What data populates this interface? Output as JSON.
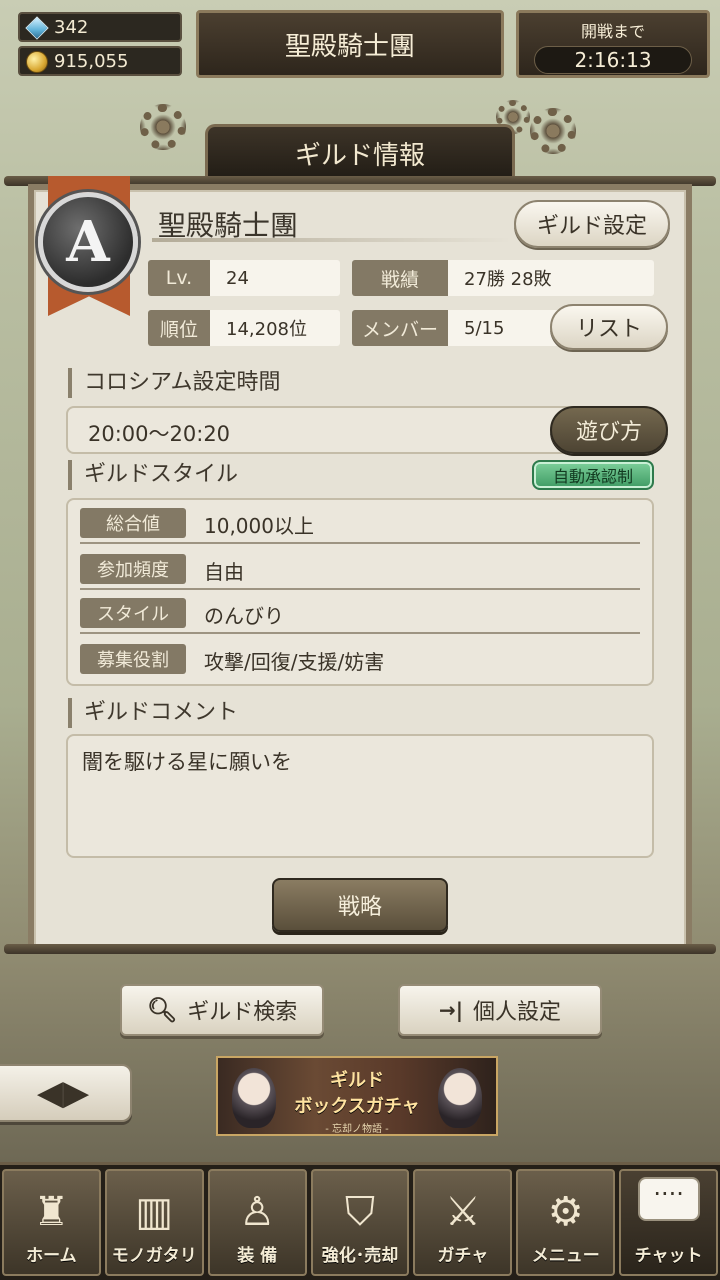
{
  "header": {
    "gems": "342",
    "coins": "915,055",
    "guild_title": "聖殿騎士團",
    "battle_label": "開戦まで",
    "battle_timer": "2:16:13"
  },
  "panel": {
    "title": "ギルド情報",
    "emblem_letter": "A",
    "guild_name": "聖殿騎士團",
    "settings_button": "ギルド設定",
    "stats": {
      "level_label": "Lv.",
      "level_value": "24",
      "record_label": "戦績",
      "record_value": "27勝 28敗",
      "rank_label": "順位",
      "rank_value": "14,208位",
      "members_label": "メンバー",
      "members_value": "5/15",
      "list_button": "リスト"
    },
    "colosseum": {
      "heading": "コロシアム設定時間",
      "time": "20:00〜20:20",
      "howto_button": "遊び方"
    },
    "style": {
      "heading": "ギルドスタイル",
      "auto_badge": "自動承認制",
      "rows": [
        {
          "label": "総合値",
          "value": "10,000以上"
        },
        {
          "label": "参加頻度",
          "value": "自由"
        },
        {
          "label": "スタイル",
          "value": "のんびり"
        },
        {
          "label": "募集役割",
          "value": "攻撃/回復/支援/妨害"
        }
      ]
    },
    "comment": {
      "heading": "ギルドコメント",
      "text": "闇を駆ける星に願いを"
    },
    "strategy_button": "戦略"
  },
  "actions": {
    "search_button": "ギルド検索",
    "personal_button": "個人設定"
  },
  "banner": {
    "line1": "ギルド",
    "line2": "ボックスガチャ",
    "line3": "- 忘却ノ物語 -"
  },
  "nav": {
    "items": [
      {
        "label": "ホーム",
        "icon": "castle-icon"
      },
      {
        "label": "モノガタリ",
        "icon": "book-icon"
      },
      {
        "label": "装 備",
        "icon": "puppet-icon"
      },
      {
        "label": "強化･売却",
        "icon": "helmet-icon"
      },
      {
        "label": "ガチャ",
        "icon": "swords-icon"
      },
      {
        "label": "メニュー",
        "icon": "gears-icon"
      },
      {
        "label": "チャット",
        "icon": "chat-icon"
      }
    ],
    "chat_dots": "····"
  },
  "colors": {
    "accent_green": "#3e9a63",
    "ribbon_orange": "#b75a2e",
    "label_bg": "#837965"
  }
}
